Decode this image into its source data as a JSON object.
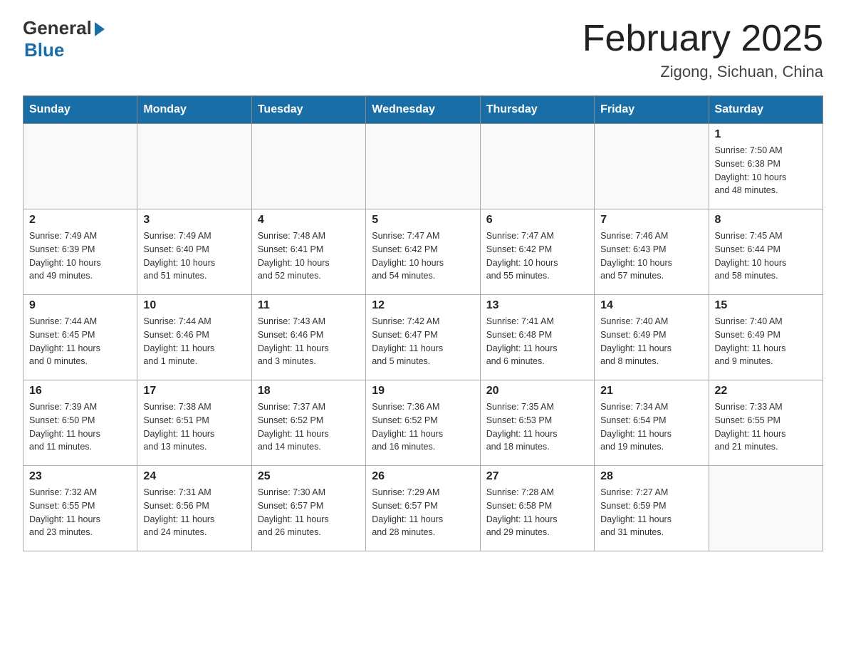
{
  "header": {
    "logo_general": "General",
    "logo_blue": "Blue",
    "month_title": "February 2025",
    "location": "Zigong, Sichuan, China"
  },
  "days_of_week": [
    "Sunday",
    "Monday",
    "Tuesday",
    "Wednesday",
    "Thursday",
    "Friday",
    "Saturday"
  ],
  "weeks": [
    [
      {
        "day": "",
        "info": ""
      },
      {
        "day": "",
        "info": ""
      },
      {
        "day": "",
        "info": ""
      },
      {
        "day": "",
        "info": ""
      },
      {
        "day": "",
        "info": ""
      },
      {
        "day": "",
        "info": ""
      },
      {
        "day": "1",
        "info": "Sunrise: 7:50 AM\nSunset: 6:38 PM\nDaylight: 10 hours\nand 48 minutes."
      }
    ],
    [
      {
        "day": "2",
        "info": "Sunrise: 7:49 AM\nSunset: 6:39 PM\nDaylight: 10 hours\nand 49 minutes."
      },
      {
        "day": "3",
        "info": "Sunrise: 7:49 AM\nSunset: 6:40 PM\nDaylight: 10 hours\nand 51 minutes."
      },
      {
        "day": "4",
        "info": "Sunrise: 7:48 AM\nSunset: 6:41 PM\nDaylight: 10 hours\nand 52 minutes."
      },
      {
        "day": "5",
        "info": "Sunrise: 7:47 AM\nSunset: 6:42 PM\nDaylight: 10 hours\nand 54 minutes."
      },
      {
        "day": "6",
        "info": "Sunrise: 7:47 AM\nSunset: 6:42 PM\nDaylight: 10 hours\nand 55 minutes."
      },
      {
        "day": "7",
        "info": "Sunrise: 7:46 AM\nSunset: 6:43 PM\nDaylight: 10 hours\nand 57 minutes."
      },
      {
        "day": "8",
        "info": "Sunrise: 7:45 AM\nSunset: 6:44 PM\nDaylight: 10 hours\nand 58 minutes."
      }
    ],
    [
      {
        "day": "9",
        "info": "Sunrise: 7:44 AM\nSunset: 6:45 PM\nDaylight: 11 hours\nand 0 minutes."
      },
      {
        "day": "10",
        "info": "Sunrise: 7:44 AM\nSunset: 6:46 PM\nDaylight: 11 hours\nand 1 minute."
      },
      {
        "day": "11",
        "info": "Sunrise: 7:43 AM\nSunset: 6:46 PM\nDaylight: 11 hours\nand 3 minutes."
      },
      {
        "day": "12",
        "info": "Sunrise: 7:42 AM\nSunset: 6:47 PM\nDaylight: 11 hours\nand 5 minutes."
      },
      {
        "day": "13",
        "info": "Sunrise: 7:41 AM\nSunset: 6:48 PM\nDaylight: 11 hours\nand 6 minutes."
      },
      {
        "day": "14",
        "info": "Sunrise: 7:40 AM\nSunset: 6:49 PM\nDaylight: 11 hours\nand 8 minutes."
      },
      {
        "day": "15",
        "info": "Sunrise: 7:40 AM\nSunset: 6:49 PM\nDaylight: 11 hours\nand 9 minutes."
      }
    ],
    [
      {
        "day": "16",
        "info": "Sunrise: 7:39 AM\nSunset: 6:50 PM\nDaylight: 11 hours\nand 11 minutes."
      },
      {
        "day": "17",
        "info": "Sunrise: 7:38 AM\nSunset: 6:51 PM\nDaylight: 11 hours\nand 13 minutes."
      },
      {
        "day": "18",
        "info": "Sunrise: 7:37 AM\nSunset: 6:52 PM\nDaylight: 11 hours\nand 14 minutes."
      },
      {
        "day": "19",
        "info": "Sunrise: 7:36 AM\nSunset: 6:52 PM\nDaylight: 11 hours\nand 16 minutes."
      },
      {
        "day": "20",
        "info": "Sunrise: 7:35 AM\nSunset: 6:53 PM\nDaylight: 11 hours\nand 18 minutes."
      },
      {
        "day": "21",
        "info": "Sunrise: 7:34 AM\nSunset: 6:54 PM\nDaylight: 11 hours\nand 19 minutes."
      },
      {
        "day": "22",
        "info": "Sunrise: 7:33 AM\nSunset: 6:55 PM\nDaylight: 11 hours\nand 21 minutes."
      }
    ],
    [
      {
        "day": "23",
        "info": "Sunrise: 7:32 AM\nSunset: 6:55 PM\nDaylight: 11 hours\nand 23 minutes."
      },
      {
        "day": "24",
        "info": "Sunrise: 7:31 AM\nSunset: 6:56 PM\nDaylight: 11 hours\nand 24 minutes."
      },
      {
        "day": "25",
        "info": "Sunrise: 7:30 AM\nSunset: 6:57 PM\nDaylight: 11 hours\nand 26 minutes."
      },
      {
        "day": "26",
        "info": "Sunrise: 7:29 AM\nSunset: 6:57 PM\nDaylight: 11 hours\nand 28 minutes."
      },
      {
        "day": "27",
        "info": "Sunrise: 7:28 AM\nSunset: 6:58 PM\nDaylight: 11 hours\nand 29 minutes."
      },
      {
        "day": "28",
        "info": "Sunrise: 7:27 AM\nSunset: 6:59 PM\nDaylight: 11 hours\nand 31 minutes."
      },
      {
        "day": "",
        "info": ""
      }
    ]
  ]
}
